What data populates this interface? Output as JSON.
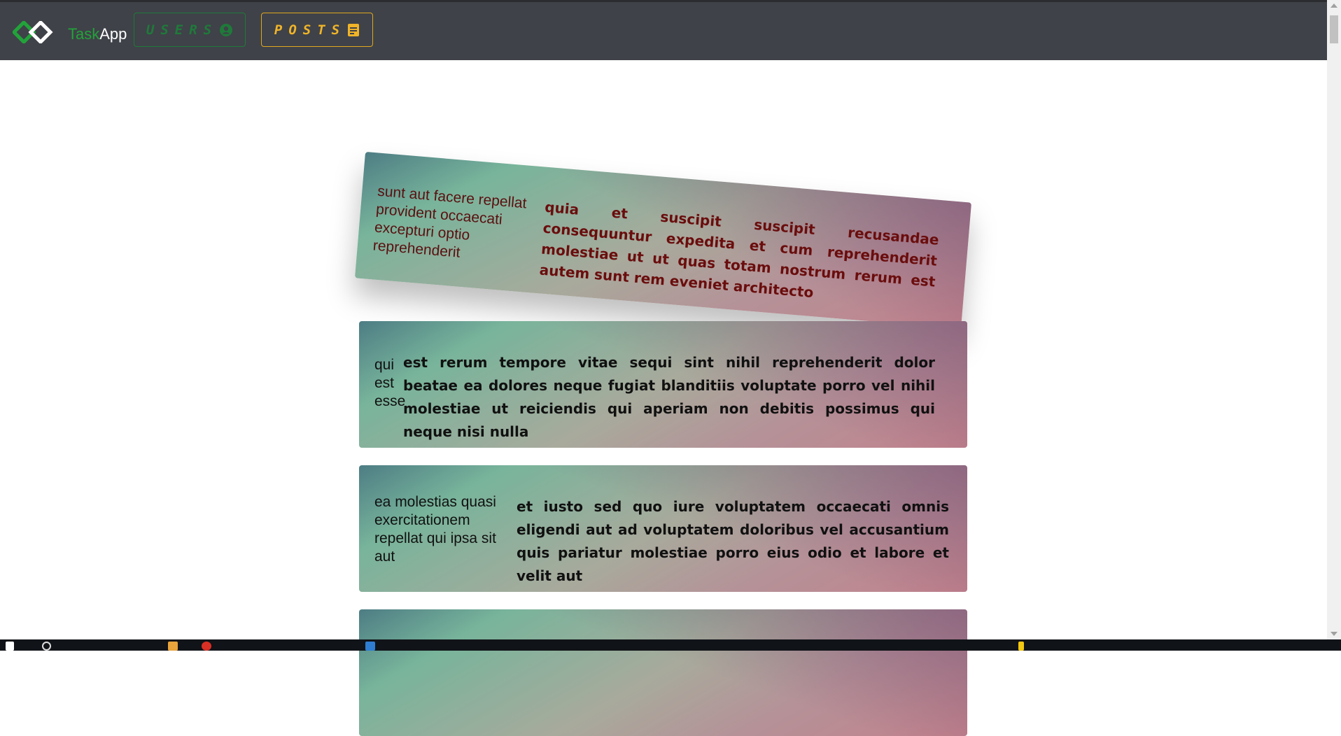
{
  "navbar": {
    "brand_task": "Task",
    "brand_app": "App",
    "users_label": "USERS",
    "posts_label": "POSTS"
  },
  "posts": [
    {
      "title": "sunt aut facere repellat provident occaecati excepturi optio reprehenderit",
      "body": "quia et suscipit suscipit recusandae consequuntur expedita et cum reprehenderit molestiae ut ut quas totam nostrum rerum est autem sunt rem eveniet architecto"
    },
    {
      "title": "qui est esse",
      "body": "est rerum tempore vitae sequi sint nihil reprehenderit dolor beatae ea dolores neque fugiat blanditiis voluptate porro vel nihil molestiae ut reiciendis qui aperiam non debitis possimus qui neque nisi nulla"
    },
    {
      "title": "ea molestias quasi exercitationem repellat qui ipsa sit aut",
      "body": "et iusto sed quo iure voluptatem occaecati omnis eligendi aut ad voluptatem doloribus vel accusantium quis pariatur molestiae porro eius odio et labore et velit aut"
    },
    {
      "title": "",
      "body": ""
    }
  ],
  "colors": {
    "navbar_bg": "#3f4248",
    "users_accent": "#1f7a3a",
    "posts_accent": "#f0b429",
    "brand_green": "#22a33a"
  },
  "icons": [
    "logo-icon",
    "user-circle-icon",
    "post-note-icon"
  ]
}
